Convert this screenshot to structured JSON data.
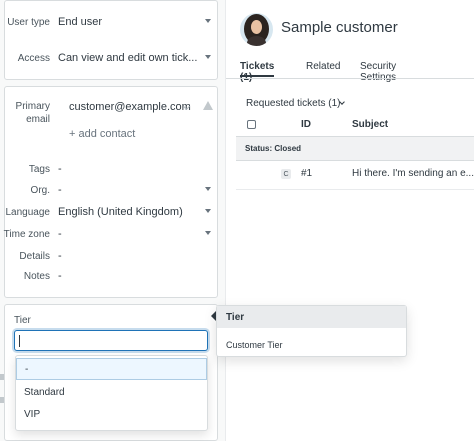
{
  "user_fields": {
    "user_type": {
      "label": "User type",
      "value": "End user"
    },
    "access": {
      "label": "Access",
      "value": "Can view and edit own tick..."
    }
  },
  "contact": {
    "primary_email_label": "Primary email",
    "primary_email": "customer@example.com",
    "add_contact": "+ add contact"
  },
  "details": {
    "tags": {
      "label": "Tags",
      "value": "-"
    },
    "org": {
      "label": "Org.",
      "value": "-"
    },
    "language": {
      "label": "Language",
      "value": "English (United Kingdom)"
    },
    "time_zone": {
      "label": "Time zone",
      "value": "-"
    },
    "details": {
      "label": "Details",
      "value": "-"
    },
    "notes": {
      "label": "Notes",
      "value": "-"
    }
  },
  "tier_field": {
    "label": "Tier",
    "value": "",
    "options": [
      "-",
      "Standard",
      "VIP"
    ],
    "highlighted_index": 0
  },
  "tooltip": {
    "title": "Tier",
    "body": "Customer Tier"
  },
  "customer": {
    "name": "Sample customer",
    "avatar_icon": "avatar-woman"
  },
  "tabs": [
    {
      "label": "Tickets (1)",
      "active": true
    },
    {
      "label": "Related",
      "active": false
    },
    {
      "label": "Security Settings",
      "active": false
    }
  ],
  "requested": {
    "title": "Requested tickets (1)",
    "columns": {
      "id": "ID",
      "subject": "Subject"
    },
    "group_label": "Status:",
    "group_value": "Closed",
    "rows": [
      {
        "type_badge": "C",
        "id": "#1",
        "subject": "Hi there. I'm sending an e..."
      }
    ]
  }
}
